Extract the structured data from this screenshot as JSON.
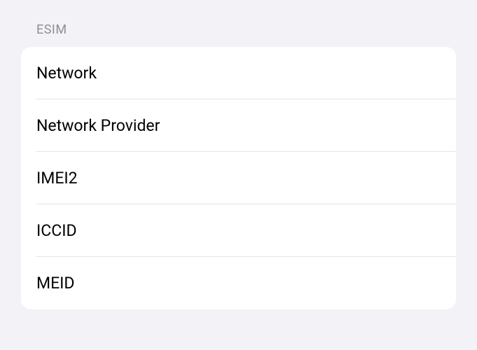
{
  "section": {
    "header": "ESIM",
    "rows": [
      {
        "label": "Network",
        "value": ""
      },
      {
        "label": "Network Provider",
        "value": ""
      },
      {
        "label": "IMEI2",
        "value": ""
      },
      {
        "label": "ICCID",
        "value": ""
      },
      {
        "label": "MEID",
        "value": ""
      }
    ]
  }
}
